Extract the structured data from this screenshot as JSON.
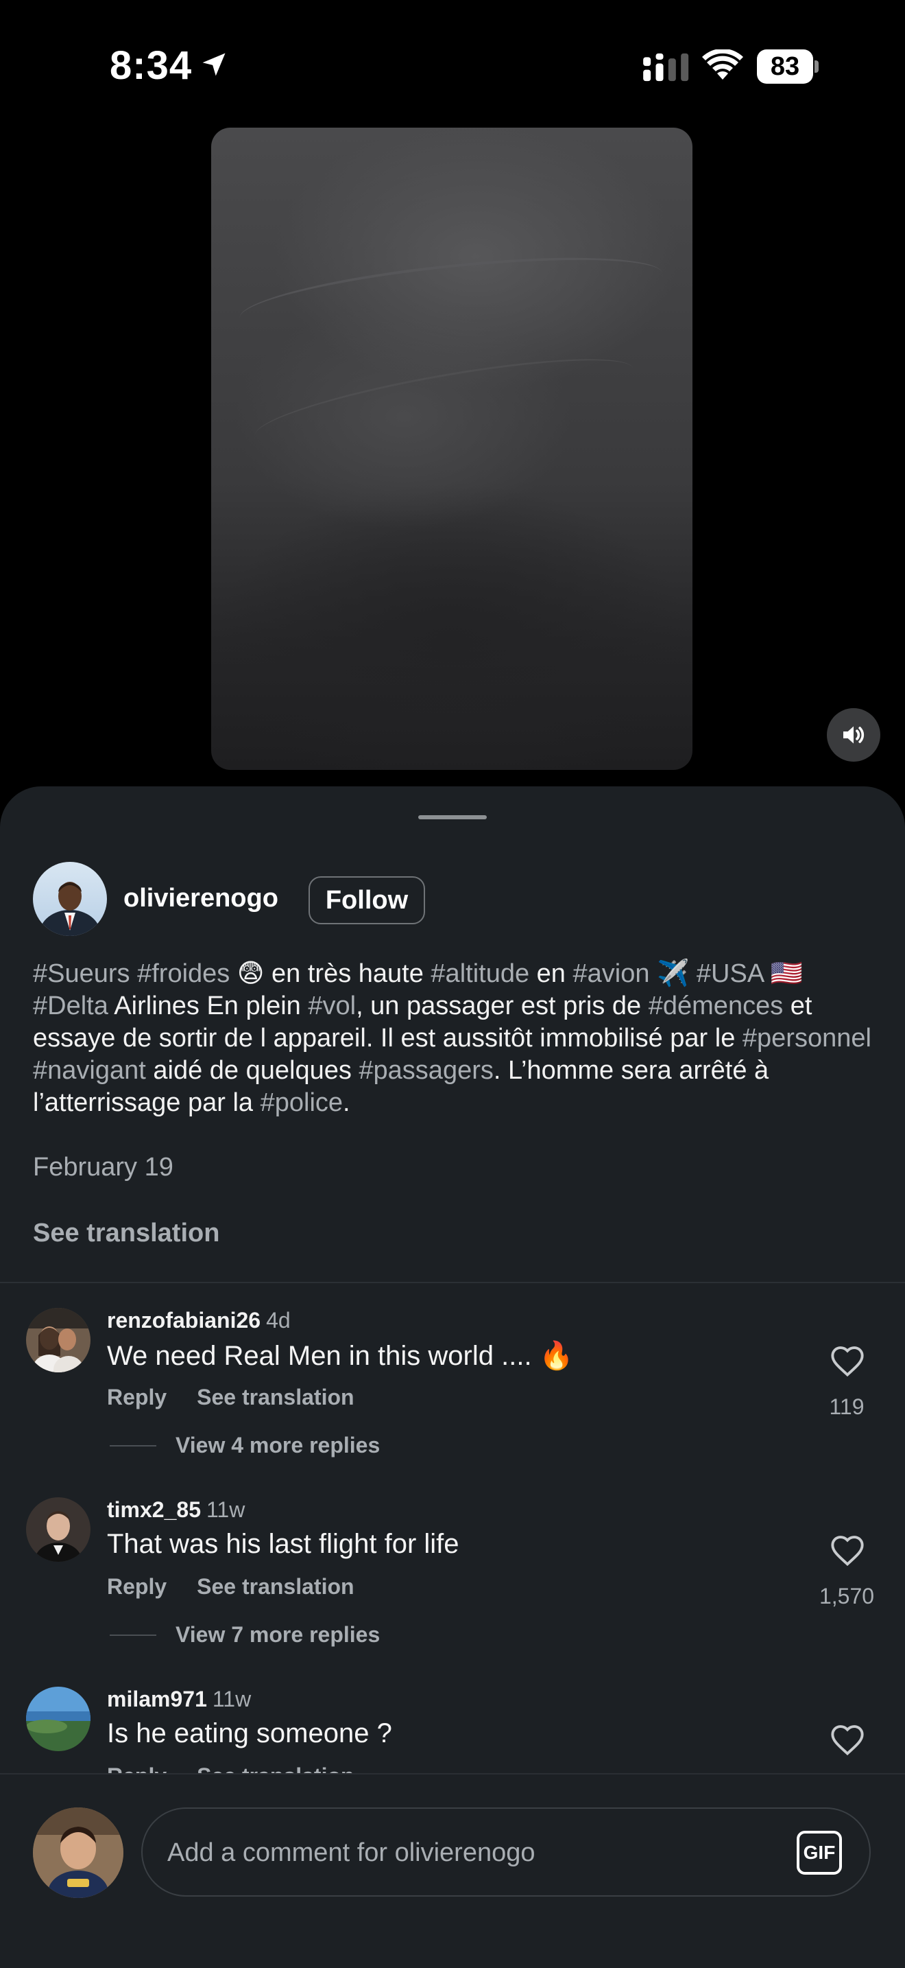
{
  "status_bar": {
    "time": "8:34",
    "battery": "83",
    "icons": [
      "location-arrow-icon",
      "signal-bars-icon",
      "wifi-icon",
      "battery-icon"
    ]
  },
  "video": {
    "sound_icon": "speaker-icon"
  },
  "post": {
    "author": "olivierenogo",
    "follow_label": "Follow",
    "caption": {
      "t1": "#Sueurs",
      "t2": " ",
      "t3": "#froides",
      "t4": " 😨 en très haute ",
      "t5": "#altitude",
      "t6": " en ",
      "t7": "#avion",
      "t8": " ✈️ ",
      "t9": "#USA",
      "t10": " 🇺🇸 ",
      "t11": "#Delta",
      "t12": " Airlines En plein ",
      "t13": "#vol",
      "t14": ", un passager est pris de ",
      "t15": "#démences",
      "t16": " et essaye de sortir de l appareil. Il est aussitôt immobilisé par le ",
      "t17": "#personnel",
      "t18": " ",
      "t19": "#navigant",
      "t20": " aidé de quelques ",
      "t21": "#passagers",
      "t22": ". L’homme sera arrêté à l’atterrissage par la ",
      "t23": "#police",
      "t24": "."
    },
    "date": "February 19",
    "see_translation": "See translation"
  },
  "comments": [
    {
      "user": "renzofabiani26",
      "time": "4d",
      "text": "We need Real Men in this world .... 🔥",
      "reply": "Reply",
      "see_translation": "See translation",
      "view_replies": "View 4 more replies",
      "likes": "119"
    },
    {
      "user": "timx2_85",
      "time": "11w",
      "text": "That was his last flight for life",
      "reply": "Reply",
      "see_translation": "See translation",
      "view_replies": "View 7 more replies",
      "likes": "1,570"
    },
    {
      "user": "milam971",
      "time": "11w",
      "text": "Is he eating someone ?",
      "reply": "Reply",
      "see_translation": "See translation"
    }
  ],
  "composer": {
    "placeholder": "Add a comment for olivierenogo",
    "gif_label": "GIF"
  },
  "colors": {
    "sheet_bg": "#1c2024",
    "hashtag": "#a9aeb3",
    "text": "#f5f5f5"
  }
}
